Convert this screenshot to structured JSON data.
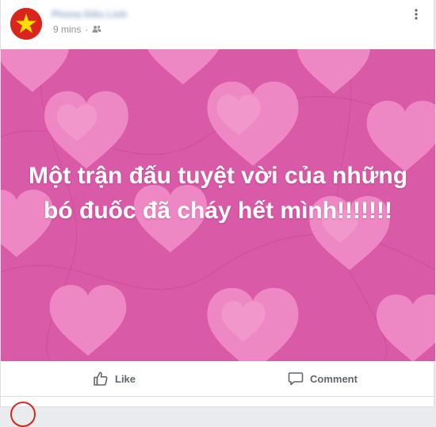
{
  "post": {
    "author_name": "Phong Diệu Linh",
    "timestamp": "9 mins",
    "separator": "·",
    "audience_icon": "friends-icon",
    "menu_icon": "more-options-icon",
    "avatar_icon": "vietnam-flag-star-icon"
  },
  "card": {
    "background_color": "#d95aa6",
    "heart_color": "#f08cc6",
    "text_color": "#ffffff",
    "message": "Một trận đấu tuyệt vời của những bó đuốc đã cháy hết mình!!!!!!!"
  },
  "actions": {
    "like_label": "Like",
    "like_icon": "thumbs-up-icon",
    "comment_label": "Comment",
    "comment_icon": "comment-bubble-icon"
  },
  "colors": {
    "action_text": "#606770",
    "meta_text": "#90949c",
    "flag_red": "#da251d",
    "flag_star": "#ffde00"
  }
}
